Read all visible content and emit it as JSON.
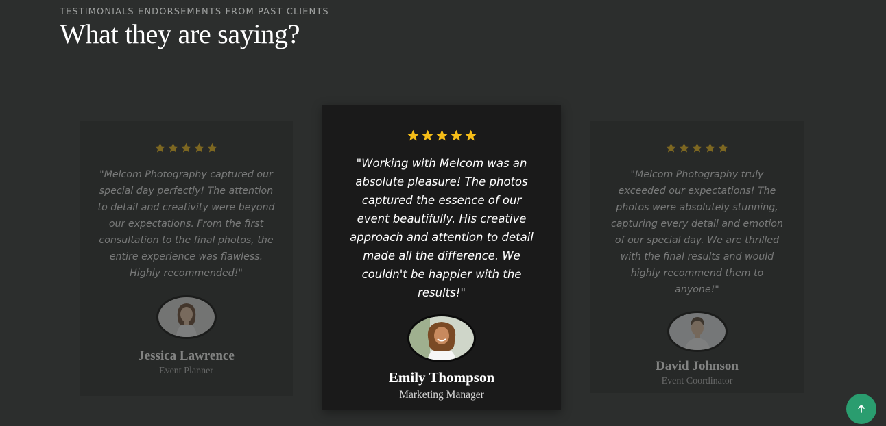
{
  "header": {
    "eyebrow": "TESTIMONIALS ENDORSEMENTS FROM PAST CLIENTS",
    "title": "What they are saying?"
  },
  "colors": {
    "background": "#2c2e2d",
    "accent": "#2fa07a",
    "star": "#f5bd18",
    "scroll_button": "#2a9d6f"
  },
  "testimonials": [
    {
      "rating": 5,
      "quote": "\"Melcom Photography captured our special day perfectly! The attention to detail and creativity were beyond our expectations. From the first consultation to the final photos, the entire experience was flawless. Highly recommended!\"",
      "name": "Jessica Lawrence",
      "role": "Event Planner",
      "avatar_icon": "woman-portrait"
    },
    {
      "rating": 5,
      "quote": "\"Working with Melcom was an absolute pleasure! The photos captured the essence of our event beautifully. His creative approach and attention to detail made all the difference. We couldn't be happier with the results!\"",
      "name": "Emily Thompson",
      "role": "Marketing Manager",
      "avatar_icon": "woman-portrait-curly-hair"
    },
    {
      "rating": 5,
      "quote": "\"Melcom Photography truly exceeded our expectations! The photos were absolutely stunning, capturing every detail and emotion of our special day. We are thrilled with the final results and would highly recommend them to anyone!\"",
      "name": "David Johnson",
      "role": "Event Coordinator",
      "avatar_icon": "man-portrait"
    }
  ],
  "scroll_top_icon": "arrow-up-icon"
}
